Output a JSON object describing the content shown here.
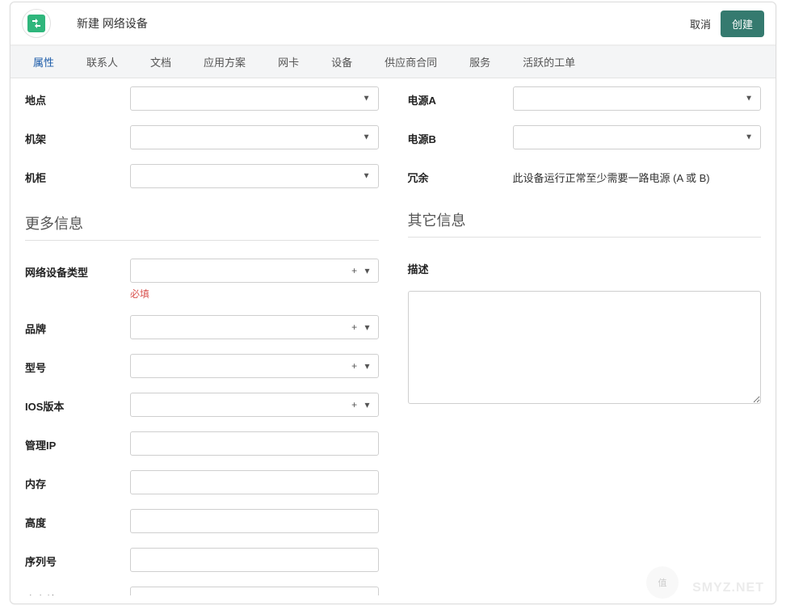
{
  "header": {
    "title": "新建 网络设备",
    "cancel": "取消",
    "create": "创建",
    "icon": "network-device-icon"
  },
  "tabs": [
    {
      "label": "属性",
      "active": true
    },
    {
      "label": "联系人",
      "active": false
    },
    {
      "label": "文档",
      "active": false
    },
    {
      "label": "应用方案",
      "active": false
    },
    {
      "label": "网卡",
      "active": false
    },
    {
      "label": "设备",
      "active": false
    },
    {
      "label": "供应商合同",
      "active": false
    },
    {
      "label": "服务",
      "active": false
    },
    {
      "label": "活跃的工单",
      "active": false
    }
  ],
  "left_top": {
    "location_label": "地点",
    "location_value": "",
    "rack_label": "机架",
    "rack_value": "",
    "enclosure_label": "机柜",
    "enclosure_value": ""
  },
  "right_top": {
    "power_a_label": "电源A",
    "power_a_value": "",
    "power_b_label": "电源B",
    "power_b_value": "",
    "redundancy_label": "冗余",
    "redundancy_text": "此设备运行正常至少需要一路电源 (A 或 B)"
  },
  "more_info": {
    "section_title": "更多信息",
    "network_type_label": "网络设备类型",
    "network_type_value": "",
    "required_text": "必填",
    "brand_label": "品牌",
    "brand_value": "",
    "model_label": "型号",
    "model_value": "",
    "ios_label": "IOS版本",
    "ios_value": "",
    "mgmt_ip_label": "管理IP",
    "mgmt_ip_value": "",
    "memory_label": "内存",
    "memory_value": "",
    "height_label": "高度",
    "height_value": "",
    "serial_label": "序列号",
    "serial_value": "",
    "asset_label": "资产编号",
    "asset_value": ""
  },
  "other_info": {
    "section_title": "其它信息",
    "description_label": "描述",
    "description_value": ""
  },
  "watermark": {
    "text1": "值",
    "text2": "SMYZ.NET"
  }
}
